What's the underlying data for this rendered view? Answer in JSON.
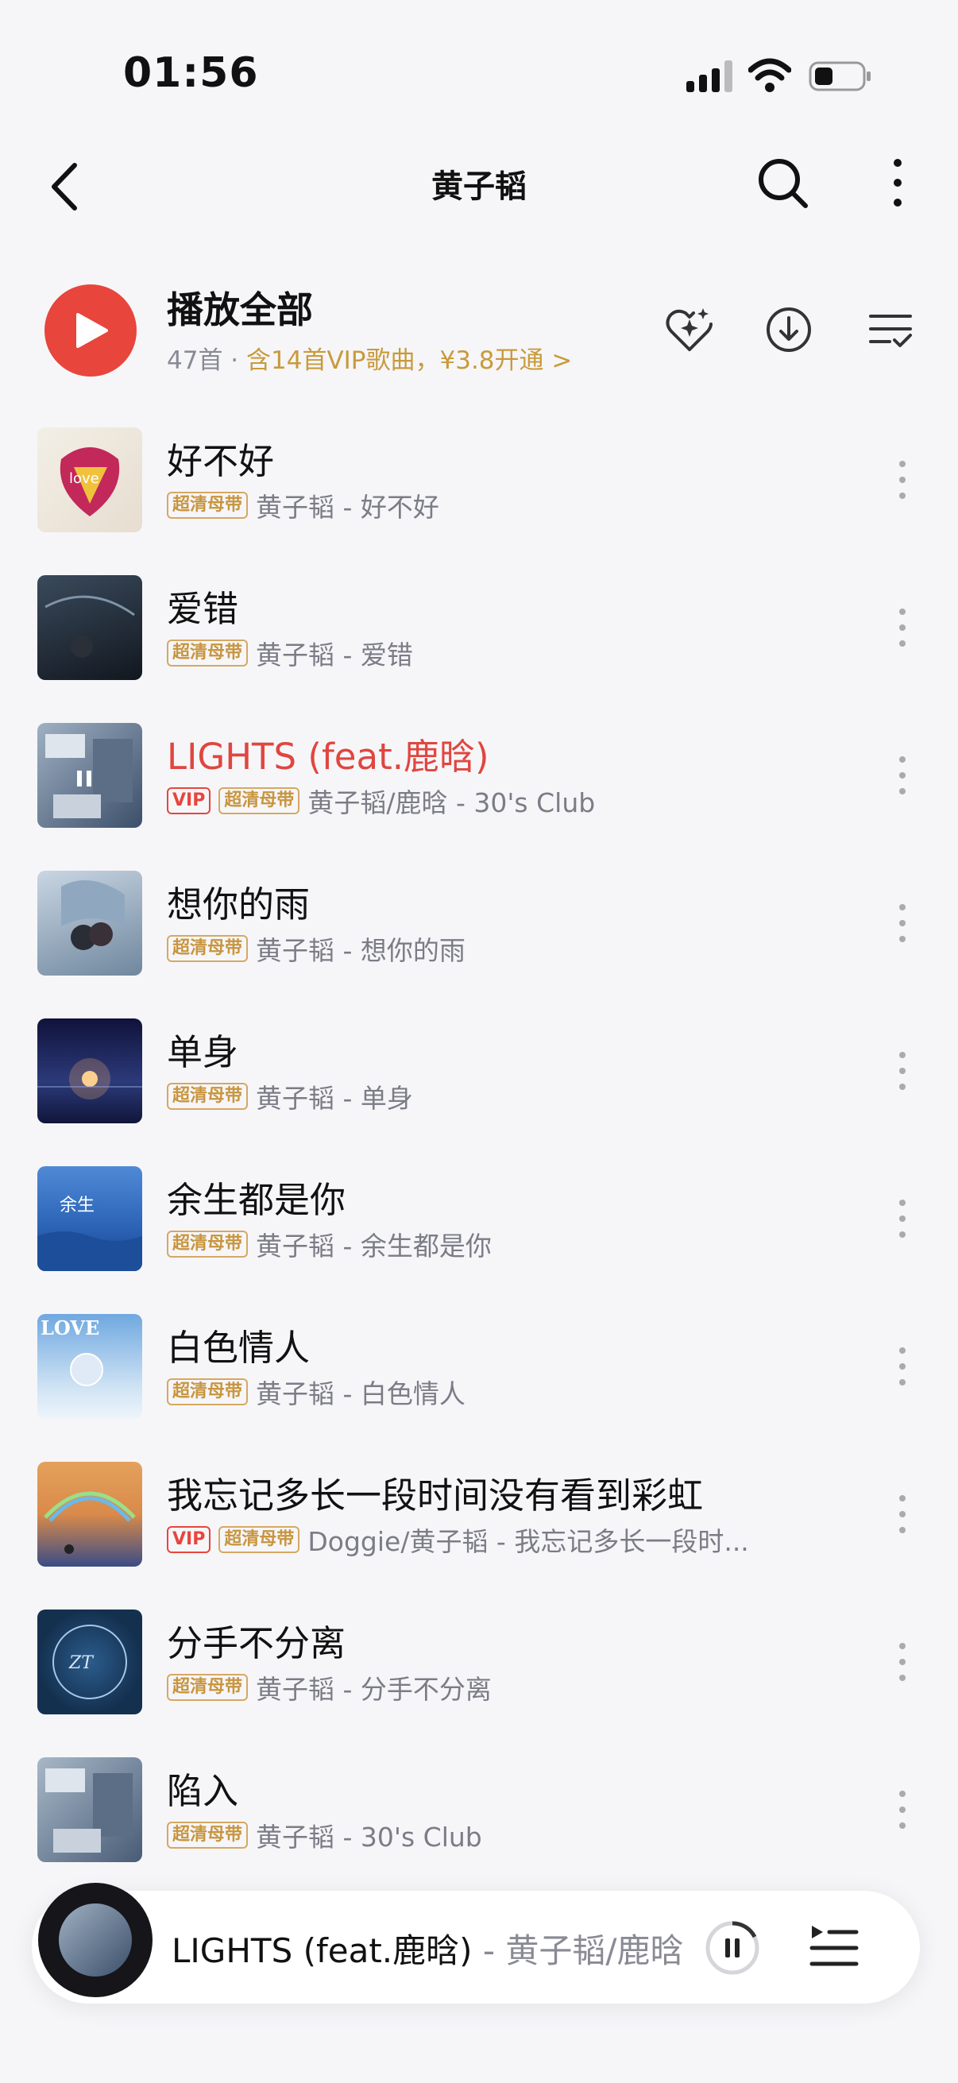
{
  "status": {
    "time": "01:56"
  },
  "nav": {
    "title": "黄子韬"
  },
  "play_all": {
    "title": "播放全部",
    "count": "47首",
    "sep": " · ",
    "vip_promo": "含14首VIP歌曲，¥3.8开通 >"
  },
  "songs": [
    {
      "title": "好不好",
      "vip": "",
      "quality": "超清母带",
      "artist": "黄子韬 - 好不好"
    },
    {
      "title": "爱错",
      "vip": "",
      "quality": "超清母带",
      "artist": "黄子韬 - 爱错"
    },
    {
      "title": "LIGHTS (feat.鹿晗)",
      "vip": "VIP",
      "quality": "超清母带",
      "artist": "黄子韬/鹿晗 - 30's Club"
    },
    {
      "title": "想你的雨",
      "vip": "",
      "quality": "超清母带",
      "artist": "黄子韬 - 想你的雨"
    },
    {
      "title": "单身",
      "vip": "",
      "quality": "超清母带",
      "artist": "黄子韬 - 单身"
    },
    {
      "title": "余生都是你",
      "vip": "",
      "quality": "超清母带",
      "artist": "黄子韬 - 余生都是你"
    },
    {
      "title": "白色情人",
      "vip": "",
      "quality": "超清母带",
      "artist": "黄子韬 - 白色情人"
    },
    {
      "title": "我忘记多长一段时间没有看到彩虹",
      "vip": "VIP",
      "quality": "超清母带",
      "artist": "Doggie/黄子韬 - 我忘记多长一段时..."
    },
    {
      "title": "分手不分离",
      "vip": "",
      "quality": "超清母带",
      "artist": "黄子韬 - 分手不分离"
    },
    {
      "title": "陷入",
      "vip": "",
      "quality": "超清母带",
      "artist": "黄子韬 - 30's Club"
    }
  ],
  "mini_player": {
    "title": "LIGHTS (feat.鹿晗)",
    "artist": " - 黄子韬/鹿晗"
  },
  "colors": {
    "accent": "#e8453c",
    "gold": "#c99a3a",
    "bg": "#f6f6f9"
  }
}
